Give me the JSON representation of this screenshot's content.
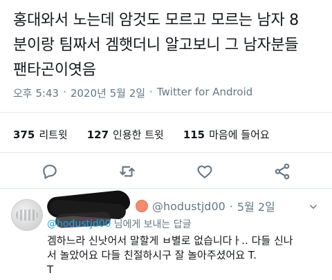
{
  "tweet": {
    "text_line1": "홍대와서 노는데 암것도 모르고 모르는 남자 8",
    "text_line2": "분이랑 팀짜서 겜햇더니 알고보니 그 남자분들",
    "text_line3": "팬타곤이엿음",
    "time": "오후 5:43",
    "sep1": "·",
    "date": "2020년 5월 2일",
    "sep2": "·",
    "client": "Twitter for Android"
  },
  "stats": {
    "retweets_count": "375",
    "retweets_label": "리트윗",
    "quotes_count": "127",
    "quotes_label": "인용한 트윗",
    "likes_count": "115",
    "likes_label": "마음에 들어요"
  },
  "actions": {
    "reply_icon": "reply-icon",
    "retweet_icon": "retweet-icon",
    "like_icon": "heart-icon",
    "share_icon": "share-icon"
  },
  "reply": {
    "handle": "@hodustjd00",
    "sep": "·",
    "date": "5월 2일",
    "reply_to_handle": "@hodustjd00",
    "reply_to_suffix": "님에게 보내는 답글",
    "body_line1": "겜하느라 신낫어서 말할게 ㅂ별로 없습니다ㅏ.. 다들 신나",
    "body_line2": "서 놀았어요 다들 친절하시구 잘 놀아주셨어요 T.",
    "body_line3": "T"
  },
  "colors": {
    "text": "#14171a",
    "muted": "#657786",
    "link": "#1da1f2",
    "divider": "#e1e8ed"
  }
}
